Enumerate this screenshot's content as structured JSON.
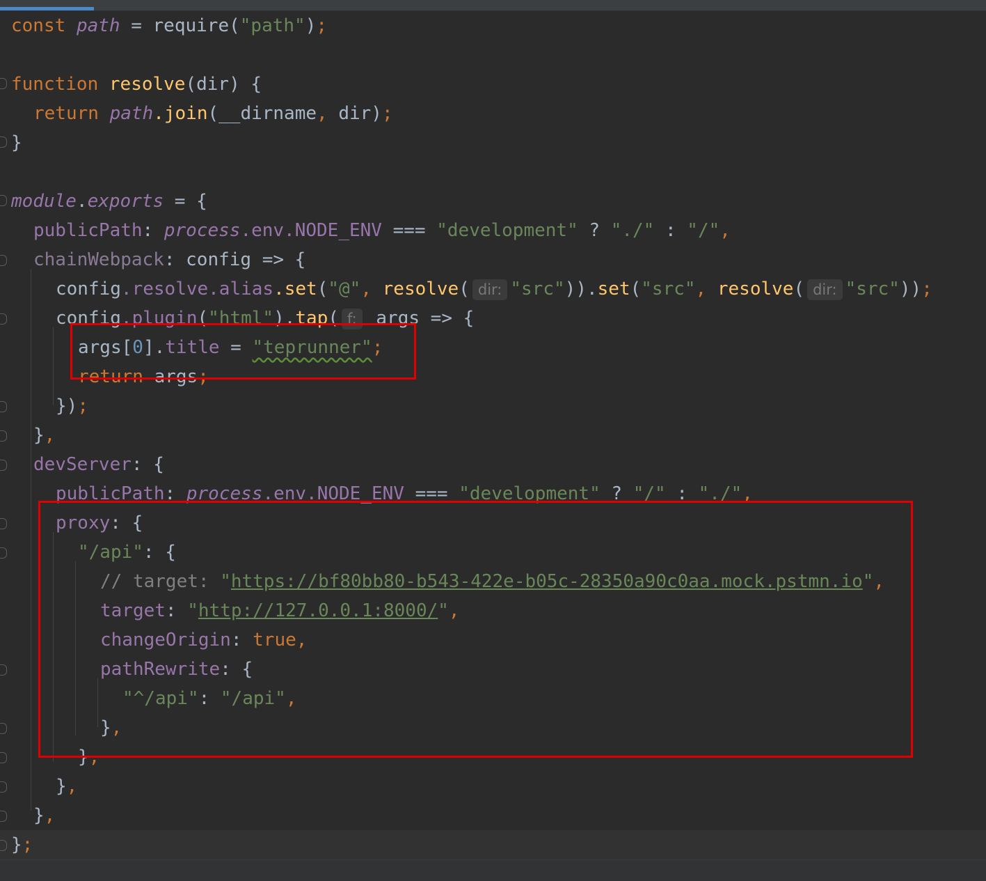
{
  "code": {
    "l1": {
      "kw": "const",
      "var": "path",
      "op": " = ",
      "fn": "require",
      "open": "(",
      "str": "\"path\"",
      "close": ")",
      "semi": ";"
    },
    "l3": {
      "kw": "function",
      "fn": "resolve",
      "rest": "(dir) {"
    },
    "l4": {
      "kw": "return",
      "var": "path",
      "fn": ".join",
      "args": "(__dirname",
      "comma": ",",
      "args2": " dir)",
      "semi": ";"
    },
    "l5": {
      "text": "}"
    },
    "l7": {
      "obj": "module",
      "dot": ".",
      "prop": "exports",
      "rest": " = {"
    },
    "l8": {
      "key": "publicPath",
      "colon": ": ",
      "proc": "process",
      "env": ".env.",
      "node": "NODE_ENV",
      "eq": " === ",
      "s1": "\"development\"",
      "q": " ? ",
      "s2": "\"./\"",
      "c": " : ",
      "s3": "\"/\"",
      "comma": ","
    },
    "l9": {
      "key": "chainWebpack",
      "rest": ": config => {"
    },
    "l10": {
      "a": "config",
      "b": ".resolve.alias",
      "c": ".set",
      "d": "(",
      "s1": "\"@\"",
      "comma1": ", ",
      "fn1": "resolve",
      "p1": "(",
      "hint1": "dir:",
      "s2": "\"src\"",
      "e": ")).",
      "fn2": "set",
      "f": "(",
      "s3": "\"src\"",
      "comma2": ", ",
      "fn3": "resolve",
      "p2": "(",
      "hint2": "dir:",
      "s4": "\"src\"",
      "g": "))",
      "semi": ";"
    },
    "l11": {
      "a": "config",
      "b": ".plugin",
      "c": "(",
      "s": "\"html\"",
      "d": ").",
      "fn": "tap",
      "e": "(",
      "hint": "f:",
      "f": " args => {"
    },
    "l12": {
      "a": "args[",
      "num": "0",
      "b": "].",
      "prop": "title",
      "c": " = ",
      "s": "\"teprunner\"",
      "semi": ";"
    },
    "l13": {
      "kw": "return",
      "rest": " args",
      "semi": ";"
    },
    "l14": {
      "a": "})",
      "semi": ";"
    },
    "l15": {
      "a": "}",
      "comma": ","
    },
    "l16": {
      "key": "devServer",
      "rest": ": {"
    },
    "l17": {
      "key": "publicPath",
      "colon": ": ",
      "proc": "process",
      "env": ".env.",
      "node": "NODE_ENV",
      "eq": " === ",
      "s1": "\"development\"",
      "q": " ? ",
      "s2": "\"/\"",
      "c": " : ",
      "s3": "\"./\"",
      "comma": ","
    },
    "l18": {
      "key": "proxy",
      "rest": ": {"
    },
    "l19": {
      "s": "\"/api\"",
      "rest": ": {"
    },
    "l20": {
      "com": "// target: ",
      "q1": "\"",
      "url": "https://bf80bb80-b543-422e-b05c-28350a90c0aa.mock.pstmn.io",
      "q2": "\"",
      "comma": ","
    },
    "l21": {
      "key": "target",
      "colon": ": ",
      "q1": "\"",
      "url": "http://127.0.0.1:8000/",
      "q2": "\"",
      "comma": ","
    },
    "l22": {
      "key": "changeOrigin",
      "colon": ": ",
      "kw": "true",
      "comma": ","
    },
    "l23": {
      "key": "pathRewrite",
      "rest": ": {"
    },
    "l24": {
      "s1": "\"^/api\"",
      "colon": ": ",
      "s2": "\"/api\"",
      "comma": ","
    },
    "l25": {
      "a": "}",
      "comma": ","
    },
    "l26": {
      "a": "}",
      "comma": ","
    },
    "l27": {
      "a": "}",
      "comma": ","
    },
    "l28": {
      "a": "}",
      "comma": ","
    },
    "l29": {
      "a": "}",
      "semi": ";"
    }
  },
  "colors": {
    "keyword": "#cc7832",
    "string": "#6a8759",
    "property": "#9876aa",
    "function": "#ffc66d",
    "number": "#6897bb",
    "highlight": "#e00000"
  }
}
